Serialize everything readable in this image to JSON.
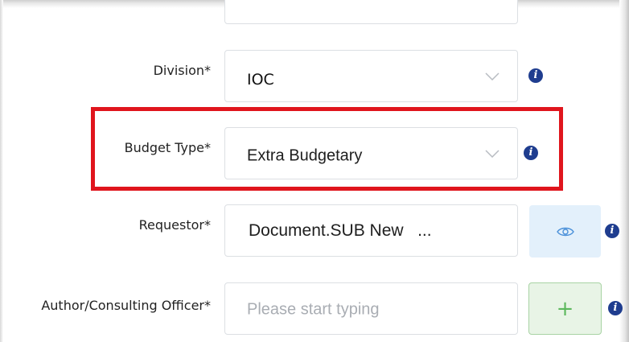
{
  "form": {
    "division": {
      "label": "Division*",
      "value": "IOC"
    },
    "budget_type": {
      "label": "Budget Type*",
      "value": "Extra Budgetary"
    },
    "requestor": {
      "label": "Requestor*",
      "value": "Document.SUB New   ..."
    },
    "author": {
      "label": "Author/Consulting Officer*",
      "placeholder": "Please start typing"
    }
  },
  "icons": {
    "info": "i",
    "view": "eye-icon",
    "add": "+"
  },
  "colors": {
    "highlight": "#e0151d",
    "info_icon": "#1f3d8f",
    "view_button_bg": "#e3f0fb",
    "add_button_bg": "#e8f4e6"
  }
}
